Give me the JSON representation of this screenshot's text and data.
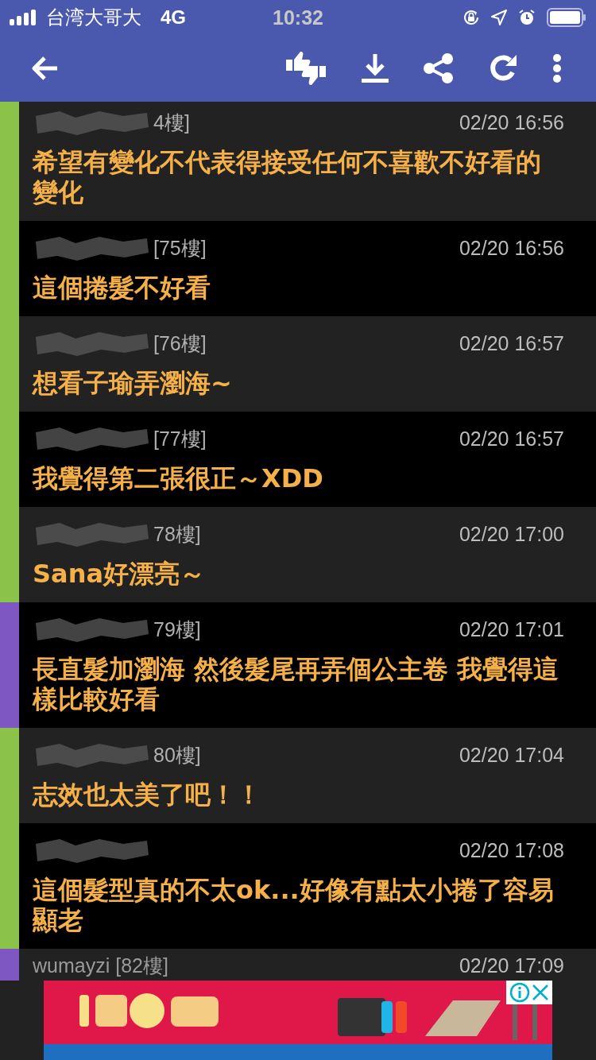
{
  "status_bar": {
    "carrier": "台湾大哥大",
    "network": "4G",
    "time": "10:32"
  },
  "comments": [
    {
      "redacted": true,
      "user_label": "4樓]",
      "time": "02/20 16:56",
      "text": "希望有變化不代表得接受任何不喜歡不好看的變化",
      "color": "#8bc34a"
    },
    {
      "redacted": true,
      "user_label": "[75樓]",
      "time": "02/20 16:56",
      "text": "這個捲髮不好看",
      "color": "#8bc34a"
    },
    {
      "redacted": true,
      "user_label": "[76樓]",
      "time": "02/20 16:57",
      "text": "想看子瑜弄瀏海~",
      "color": "#8bc34a"
    },
    {
      "redacted": true,
      "user_label": "[77樓]",
      "time": "02/20 16:57",
      "text": "我覺得第二張很正～XDD",
      "color": "#8bc34a"
    },
    {
      "redacted": true,
      "user_label": "78樓]",
      "time": "02/20 17:00",
      "text": "Sana好漂亮～",
      "color": "#8bc34a"
    },
    {
      "redacted": true,
      "user_label": "79樓]",
      "time": "02/20 17:01",
      "text": "長直髮加瀏海 然後髮尾再弄個公主卷 我覺得這樣比較好看",
      "color": "#7e57c2"
    },
    {
      "redacted": true,
      "user_label": "80樓]",
      "time": "02/20 17:04",
      "text": "志效也太美了吧！！",
      "color": "#8bc34a"
    },
    {
      "redacted": true,
      "time": "02/20 17:08",
      "text": "這個髮型真的不太ok...好像有點太小捲了容易顯老",
      "color": "#8bc34a"
    },
    {
      "redacted": false,
      "user_label": "wumayzi  [82樓]",
      "time": "02/20 17:09",
      "color": "#7e57c2"
    }
  ]
}
